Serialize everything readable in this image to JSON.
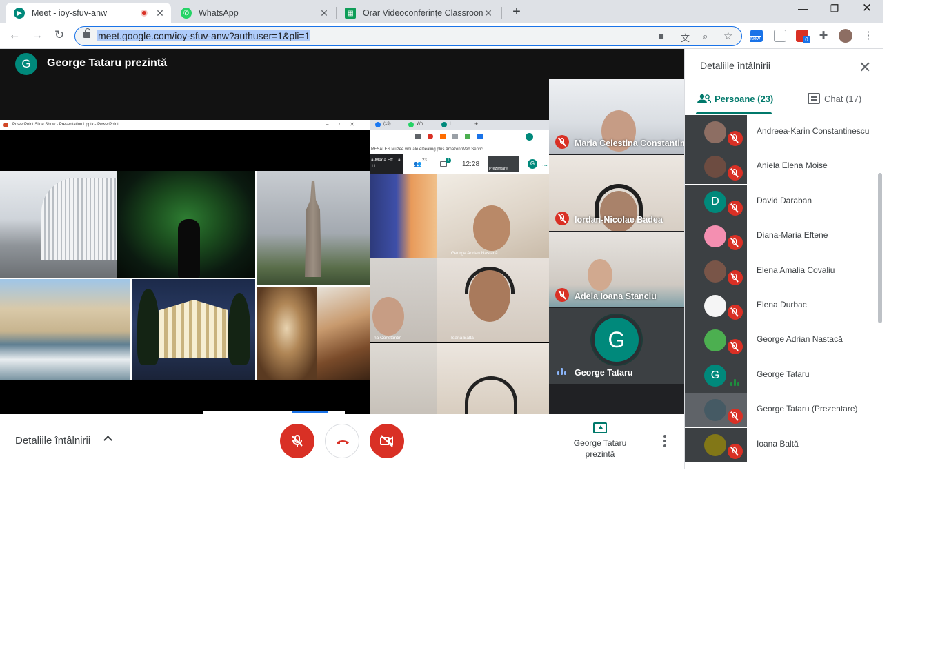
{
  "browser": {
    "tabs": [
      {
        "title": "Meet - ioy-sfuv-anw",
        "active": true,
        "recording": true
      },
      {
        "title": "WhatsApp",
        "active": false
      },
      {
        "title": "Orar Videoconferințe Classroom",
        "active": false
      }
    ],
    "url": "meet.google.com/ioy-sfuv-anw?authuser=1&pli=1",
    "ext_badges": {
      "new": "New",
      "count": "0"
    }
  },
  "meet": {
    "presenter_initial": "G",
    "presenter_title": "George Tataru prezintă",
    "shared_window_title": "PowerPoint Slide Show - Presentation1.pptx - PowerPoint",
    "mini_tabs": [
      "(13)",
      "Wh",
      "I"
    ],
    "mini_bookmarks": "RESALES  Muzee virtuale  eDealing plus  Amazon Web Servic...",
    "mini_meet": {
      "self_label": "a-Maria Eft... ă 11",
      "people_count": "23",
      "chat_count": "1",
      "clock": "12:28",
      "presentation_label": "Prezentare",
      "you_label": "Tu",
      "avatar": "G"
    },
    "mini_tiles": [
      {
        "name": ""
      },
      {
        "name": "George Adrian Nastacă"
      },
      {
        "name": "na Constantin"
      },
      {
        "name": "Ioana Baltă"
      },
      {
        "name": ""
      },
      {
        "name": ""
      }
    ],
    "participant_tiles": [
      {
        "name": "Maria Celestina Constantin"
      },
      {
        "name": "Iordan-Nicolae Badea"
      },
      {
        "name": "Adela Ioana Stanciu"
      }
    ],
    "presenter_tile": {
      "name": "George Tataru",
      "initial": "G"
    }
  },
  "controls": {
    "details_label": "Detaliile întâlnirii",
    "presenting_label": "George Tataru prezintă"
  },
  "panel": {
    "title": "Detaliile întâlnirii",
    "tab_people": "Persoane (23)",
    "tab_chat": "Chat (17)",
    "people": [
      {
        "name": "Andreea-Karin Constantinescu",
        "initial": "",
        "color": "#8d6e63",
        "muted": true
      },
      {
        "name": "Aniela Elena Moise",
        "initial": "",
        "color": "#6d4c41",
        "muted": true
      },
      {
        "name": "David Daraban",
        "initial": "D",
        "color": "#00897b",
        "muted": true
      },
      {
        "name": "Diana-Maria Eftene",
        "initial": "",
        "color": "#f48fb1",
        "muted": true
      },
      {
        "name": "Elena Amalia Covaliu",
        "initial": "",
        "color": "#795548",
        "muted": true
      },
      {
        "name": "Elena Durbac",
        "initial": "",
        "color": "#f5f5f5",
        "muted": true
      },
      {
        "name": "George Adrian Nastacă",
        "initial": "",
        "color": "#4caf50",
        "muted": true
      },
      {
        "name": "George Tataru",
        "initial": "G",
        "color": "#00897b",
        "muted": false
      },
      {
        "name": "George Tataru (Prezentare)",
        "initial": "",
        "color": "#455a64",
        "muted": true
      },
      {
        "name": "Ioana Baltă",
        "initial": "",
        "color": "#827717",
        "muted": true
      }
    ]
  }
}
